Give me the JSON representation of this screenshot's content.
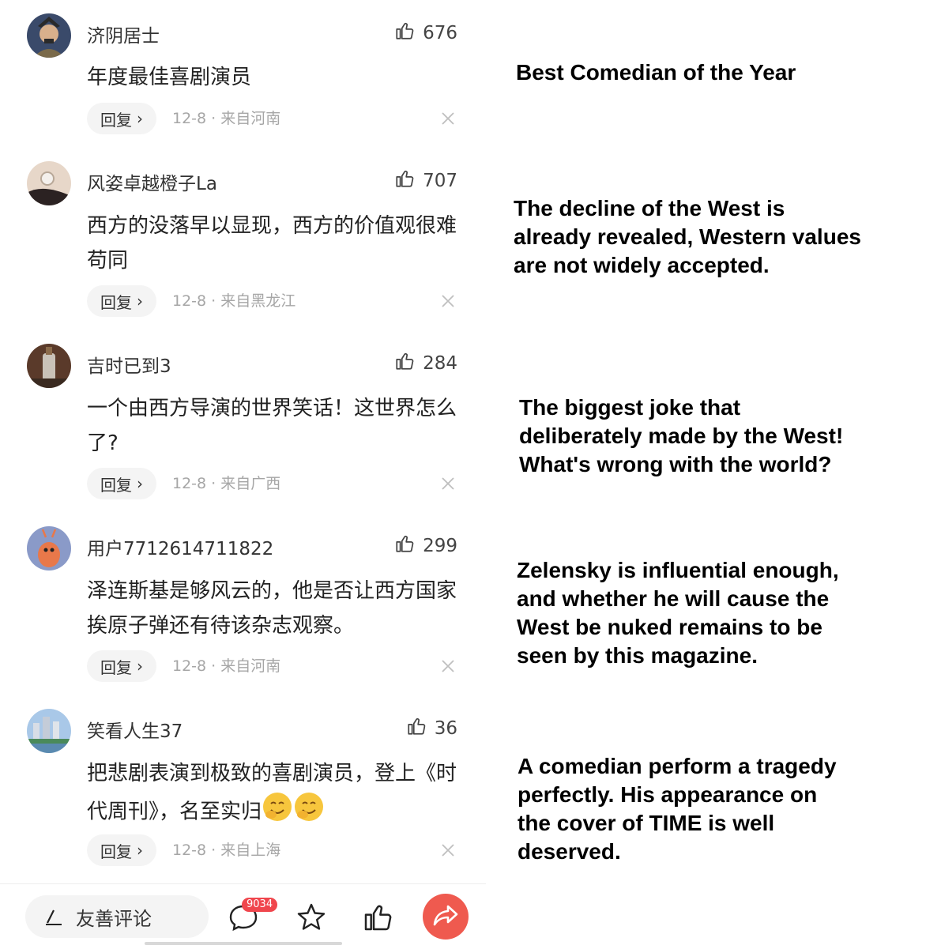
{
  "comments": [
    {
      "user": "济阴居士",
      "likes": "676",
      "text": "年度最佳喜剧演员",
      "reply": "回复",
      "meta": "12-8 · 来自河南",
      "avatar": "general-portrait"
    },
    {
      "user": "风姿卓越橙子La",
      "likes": "707",
      "text": "西方的没落早以显现，西方的价值观很难苟同",
      "reply": "回复",
      "meta": "12-8 · 来自黑龙江",
      "avatar": "earring-photo"
    },
    {
      "user": "吉时已到3",
      "likes": "284",
      "text": "一个由西方导演的世界笑话！这世界怎么了?",
      "reply": "回复",
      "meta": "12-8 · 来自广西",
      "avatar": "bottle-photo"
    },
    {
      "user": "用户7712614711822",
      "likes": "299",
      "text": "泽连斯基是够风云的，他是否让西方国家挨原子弹还有待该杂志观察。",
      "reply": "回复",
      "meta": "12-8 · 来自河南",
      "avatar": "cartoon-shrimp"
    },
    {
      "user": "笑看人生37",
      "likes": "36",
      "text": "把悲剧表演到极致的喜剧演员，登上《时代周刊》，名至实归",
      "reply": "回复",
      "meta": "12-8 · 来自上海",
      "avatar": "city-skyline"
    }
  ],
  "translations": [
    "Best Comedian of the Year",
    "The decline of the West is already revealed, Western values are not widely accepted.",
    "The biggest joke that deliberately made by the West! What's wrong with the world?",
    "Zelensky is influential enough, and whether he will cause the West be nuked remains to be seen by this magazine.",
    "A comedian perform a tragedy perfectly. His appearance on the cover of TIME is well deserved."
  ],
  "bottom_bar": {
    "composer_placeholder": "友善评论",
    "comment_count": "9034",
    "icons": [
      "pen-icon",
      "comment-icon",
      "star-icon",
      "thumbs-up-icon",
      "share-icon"
    ]
  },
  "colors": {
    "accent": "#ef5a4f",
    "badge": "#f0464d",
    "meta": "#a6a6a6"
  }
}
